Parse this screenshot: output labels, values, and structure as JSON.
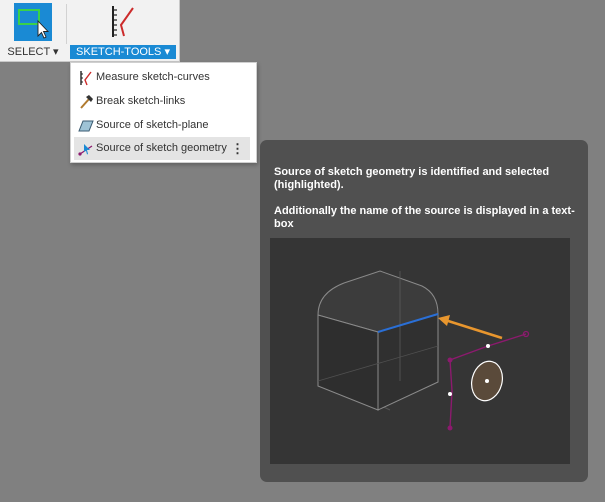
{
  "toolbar": {
    "select_label": "SELECT ▾",
    "sketch_tools_label": "SKETCH-TOOLS ▾"
  },
  "menu": {
    "items": [
      {
        "label": "Measure sketch-curves",
        "icon": "measure-curves-icon"
      },
      {
        "label": "Break sketch-links",
        "icon": "hammer-icon"
      },
      {
        "label": "Source of sketch-plane",
        "icon": "plane-icon"
      },
      {
        "label": "Source of sketch geometry",
        "icon": "source-geometry-icon",
        "highlighted": true,
        "more": "⋮"
      }
    ]
  },
  "tooltip": {
    "line1": "Source of sketch geometry is identified and selected (highlighted).",
    "line2": "Additionally the name of the source is displayed in a text-box"
  },
  "colors": {
    "accent": "#1a8ad4",
    "canvas": "#808080",
    "tooltip_bg": "#505050",
    "highlight_edge": "#2a6fd6",
    "arrow": "#e8962e",
    "sketch_line": "#8c1a6e"
  }
}
